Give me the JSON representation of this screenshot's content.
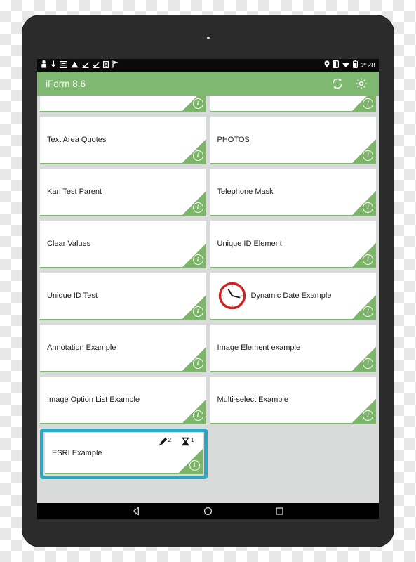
{
  "device": {
    "frame_color": "#2b2b2b",
    "screen_bg": "#d9dbda"
  },
  "status_bar": {
    "time": "2:28",
    "background": "#0a0a0a",
    "left_icons": [
      "person-notification-icon",
      "download-icon",
      "archive-icon",
      "drive-icon",
      "check-note-icon",
      "check-note-2-icon",
      "sim-card-icon",
      "flag-icon"
    ],
    "right_icons": [
      "location-pin-icon",
      "screen-rotation-icon",
      "wifi-icon",
      "battery-icon"
    ]
  },
  "app_bar": {
    "title": "iForm 8.6",
    "background": "#7fb871",
    "actions": [
      {
        "name": "sync-button",
        "icon": "sync-icon"
      },
      {
        "name": "settings-button",
        "icon": "gear-icon"
      }
    ]
  },
  "theme": {
    "accent_green": "#7fb871",
    "corner_green": "#7cb468",
    "selection_teal": "#2ba7c4",
    "card_white": "#ffffff",
    "clock_red": "#cc2222"
  },
  "form_list": {
    "rows": [
      {
        "clipped": true,
        "cards": [
          {
            "label": "",
            "icon": null,
            "info": true
          },
          {
            "label": "",
            "icon": "gear-icon",
            "info": true
          }
        ]
      },
      {
        "clipped": false,
        "cards": [
          {
            "label": "Text Area Quotes",
            "icon": null,
            "info": true
          },
          {
            "label": "PHOTOS",
            "icon": null,
            "info": true
          }
        ]
      },
      {
        "clipped": false,
        "cards": [
          {
            "label": "Karl Test Parent",
            "icon": null,
            "info": true
          },
          {
            "label": "Telephone Mask",
            "icon": null,
            "info": true
          }
        ]
      },
      {
        "clipped": false,
        "cards": [
          {
            "label": "Clear Values",
            "icon": null,
            "info": true
          },
          {
            "label": "Unique ID Element",
            "icon": null,
            "info": true
          }
        ]
      },
      {
        "clipped": false,
        "cards": [
          {
            "label": "Unique ID Test",
            "icon": null,
            "info": true
          },
          {
            "label": "Dynamic Date Example",
            "icon": "clock-icon",
            "info": true
          }
        ]
      },
      {
        "clipped": false,
        "cards": [
          {
            "label": "Annotation Example",
            "icon": null,
            "info": true
          },
          {
            "label": "Image Element example",
            "icon": null,
            "info": true
          }
        ]
      },
      {
        "clipped": false,
        "cards": [
          {
            "label": "Image Option List Example",
            "icon": null,
            "info": true
          },
          {
            "label": "Multi-select Example",
            "icon": null,
            "info": true
          }
        ]
      }
    ],
    "selected_row": {
      "label": "ESRI Example",
      "selected": true,
      "badges": [
        {
          "name": "draft-badge",
          "icon": "pencil-icon",
          "count": "2"
        },
        {
          "name": "pending-badge",
          "icon": "hourglass-icon",
          "count": "1"
        }
      ],
      "empty_slot": true
    }
  },
  "nav_bar": {
    "buttons": [
      {
        "name": "nav-back-button",
        "icon": "back-triangle-icon"
      },
      {
        "name": "nav-home-button",
        "icon": "home-circle-icon"
      },
      {
        "name": "nav-recents-button",
        "icon": "recents-square-icon"
      }
    ]
  }
}
